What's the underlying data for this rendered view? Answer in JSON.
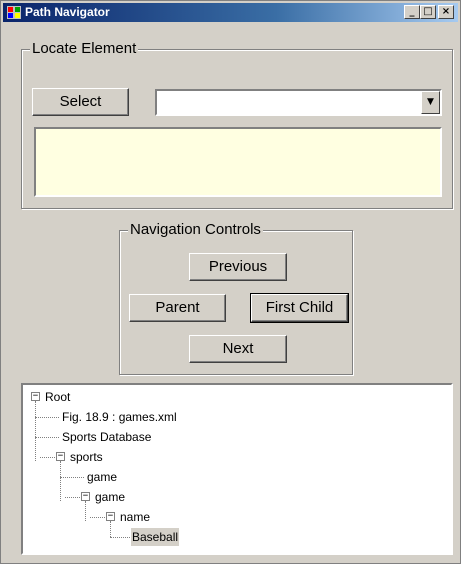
{
  "window": {
    "title": "Path Navigator"
  },
  "caption_buttons": {
    "minimize": "_",
    "maximize": "□",
    "close": "×"
  },
  "locate": {
    "group_label": "Locate Element",
    "select_button": "Select",
    "combo_value": "",
    "combo_arrow": "▼",
    "path_text": ""
  },
  "navigation": {
    "group_label": "Navigation Controls",
    "previous": "Previous",
    "parent": "Parent",
    "first_child": "First Child",
    "next": "Next"
  },
  "tree": {
    "collapse_glyph": "−",
    "nodes": [
      {
        "label": "Root",
        "expanded": true
      },
      {
        "label": "Fig. 18.9 : games.xml"
      },
      {
        "label": "Sports Database"
      },
      {
        "label": "sports",
        "expanded": true
      },
      {
        "label": "game"
      },
      {
        "label": "game",
        "expanded": true
      },
      {
        "label": "name",
        "expanded": true
      },
      {
        "label": "Baseball",
        "selected": true
      }
    ]
  }
}
